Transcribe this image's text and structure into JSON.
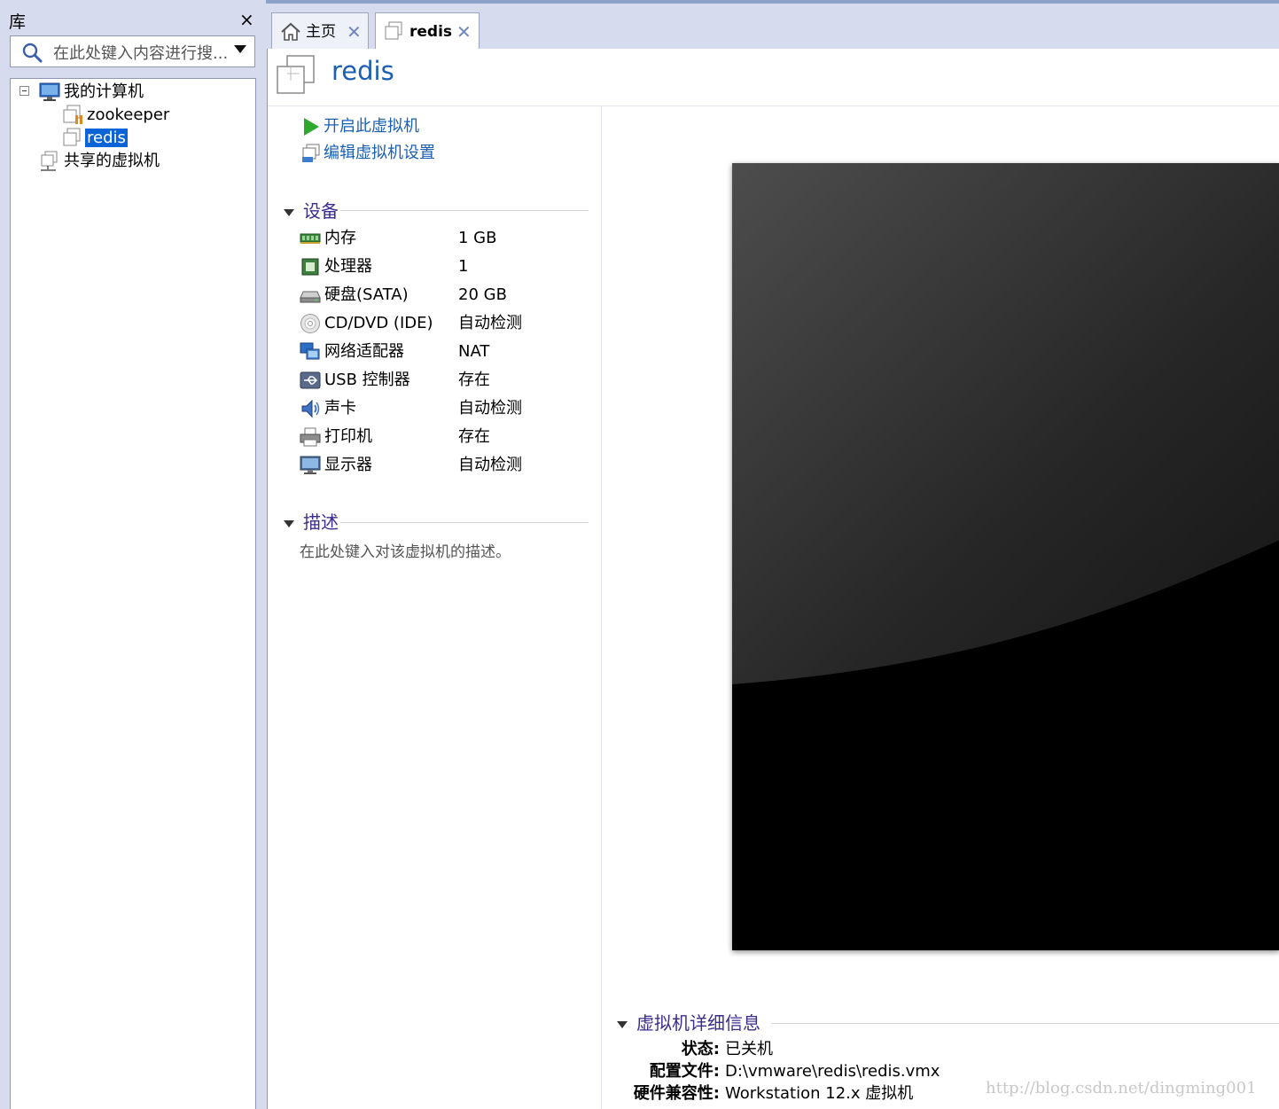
{
  "library": {
    "title": "库",
    "close_glyph": "×",
    "search": {
      "placeholder": "在此处键入内容进行搜..."
    },
    "tree": {
      "my_computer": "我的计算机",
      "vms": [
        "zookeeper",
        "redis"
      ],
      "selected": "redis",
      "shared": "共享的虚拟机"
    }
  },
  "tabs": [
    {
      "label": "主页",
      "icon": "home-icon",
      "close": "✕"
    },
    {
      "label": "redis",
      "icon": "vm-icon",
      "close": "✕",
      "active": true
    }
  ],
  "vm": {
    "title": "redis",
    "actions": {
      "power_on": "开启此虚拟机",
      "edit_settings": "编辑虚拟机设置"
    },
    "devices_header": "设备",
    "devices": [
      {
        "name": "内存",
        "value": "1 GB",
        "icon": "memory-icon"
      },
      {
        "name": "处理器",
        "value": "1",
        "icon": "processor-icon"
      },
      {
        "name": "硬盘(SATA)",
        "value": "20 GB",
        "icon": "hard-disk-icon"
      },
      {
        "name": "CD/DVD (IDE)",
        "value": "自动检测",
        "icon": "cd-dvd-icon"
      },
      {
        "name": "网络适配器",
        "value": "NAT",
        "icon": "network-adapter-icon"
      },
      {
        "name": "USB 控制器",
        "value": "存在",
        "icon": "usb-icon"
      },
      {
        "name": "声卡",
        "value": "自动检测",
        "icon": "sound-card-icon"
      },
      {
        "name": "打印机",
        "value": "存在",
        "icon": "printer-icon"
      },
      {
        "name": "显示器",
        "value": "自动检测",
        "icon": "display-icon"
      }
    ],
    "description_header": "描述",
    "description_placeholder": "在此处键入对该虚拟机的描述。",
    "details_header": "虚拟机详细信息",
    "details": {
      "state_label": "状态:",
      "state_value": "已关机",
      "config_label": "配置文件:",
      "config_value": "D:\\vmware\\redis\\redis.vmx",
      "compat_label": "硬件兼容性:",
      "compat_value": "Workstation 12.x 虚拟机"
    }
  },
  "watermark": "http://blog.csdn.net/dingming001",
  "colors": {
    "accent": "#1a5fb4",
    "section": "#3c2c8c",
    "selection": "#0a64d8",
    "chrome": "#d6dcee"
  }
}
